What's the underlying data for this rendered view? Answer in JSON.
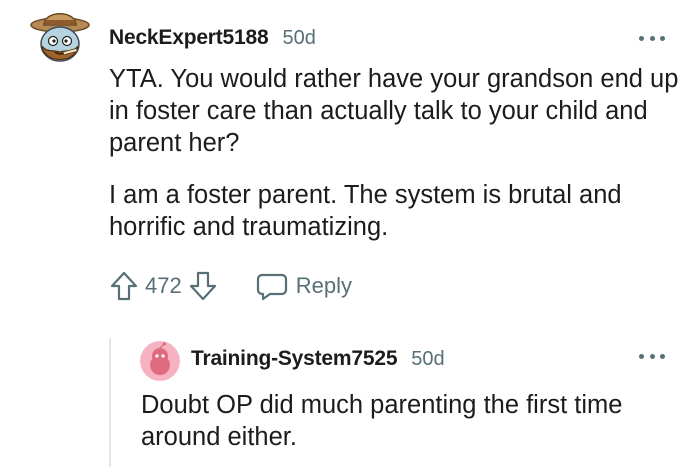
{
  "comment": {
    "author": "NeckExpert5188",
    "age": "50d",
    "paragraphs": [
      "YTA. You would rather have your grandson end up in foster care than actually talk to your child and parent her?",
      "I am a foster parent. The system is brutal and horrific and traumatizing."
    ],
    "score": "472",
    "reply_label": "Reply",
    "avatar_icon": "snoo-cowboy-avatar"
  },
  "reply": {
    "author": "Training-System7525",
    "age": "50d",
    "text": "Doubt OP did much parenting the first time around either.",
    "avatar_icon": "snoo-default-avatar",
    "avatar_color": "#f5b2c0"
  },
  "colors": {
    "text": "#1c1c1c",
    "meta": "#576f76",
    "thread_line": "#e5e5e5"
  },
  "icons": [
    "more-icon",
    "upvote-icon",
    "downvote-icon",
    "reply-icon"
  ]
}
